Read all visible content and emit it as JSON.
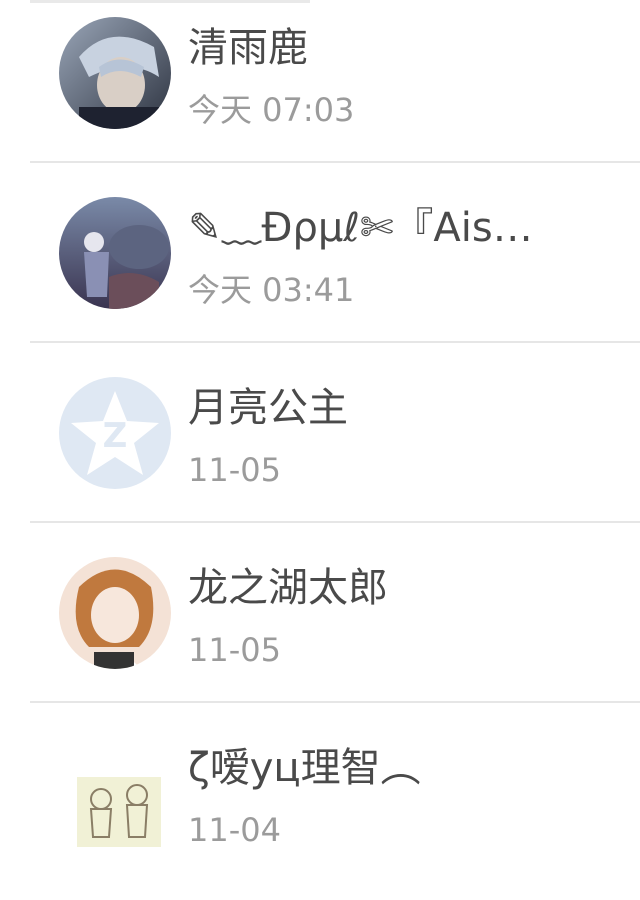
{
  "contacts": [
    {
      "name": "清雨鹿",
      "time": "今天 07:03",
      "avatar": "photo-avatar"
    },
    {
      "name": "✎﹏Ɖρµℓ✄『Aisﾠ",
      "display_name": "✎﹏Ɖρµℓ✄『Ais…",
      "time": "今天 03:41",
      "avatar": "photo-avatar"
    },
    {
      "name": "月亮公主",
      "time": "11-05",
      "avatar": "default-star-avatar"
    },
    {
      "name": "龙之湖太郎",
      "time": "11-05",
      "avatar": "illustration-avatar"
    },
    {
      "name": "ζ嗳yц理智︵",
      "time": "11-04",
      "avatar": "sketch-avatar"
    }
  ],
  "colors": {
    "name_text": "#4a4a4a",
    "time_text": "#9b9b9b",
    "divider": "#e6e6e6",
    "default_avatar_bg": "#dfe8f3"
  }
}
